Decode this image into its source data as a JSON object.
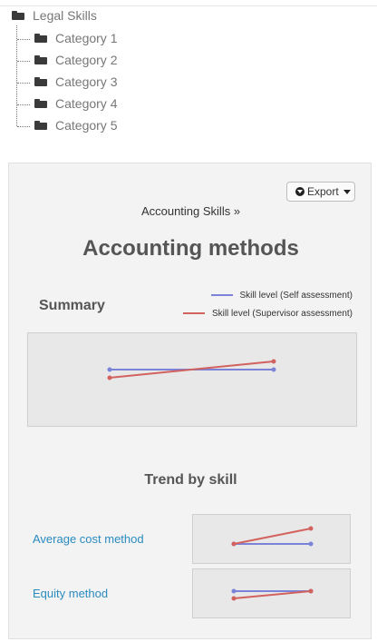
{
  "tree": {
    "root": "Legal Skills",
    "categories": [
      "Category 1",
      "Category 2",
      "Category 3",
      "Category 4",
      "Category 5"
    ]
  },
  "panel": {
    "export_label": "Export",
    "breadcrumb": "Accounting Skills »",
    "title": "Accounting methods",
    "summary_label": "Summary",
    "trend_title": "Trend by skill",
    "skills": [
      "Average cost method",
      "Equity method"
    ]
  },
  "chart_data": [
    {
      "type": "line",
      "name": "summary",
      "x": [
        1,
        2
      ],
      "series": [
        {
          "name": "Skill level (Self assessment)",
          "color": "#7b83d9",
          "values": [
            3.0,
            3.0
          ]
        },
        {
          "name": "Skill level (Supervisor assessment)",
          "color": "#d2625e",
          "values": [
            2.6,
            3.4
          ]
        }
      ],
      "legend": "top-right",
      "grid": false
    },
    {
      "type": "line",
      "name": "average-cost-method",
      "x": [
        1,
        2
      ],
      "series": [
        {
          "color": "#7b83d9",
          "values": [
            3.0,
            3.0
          ]
        },
        {
          "color": "#d2625e",
          "values": [
            3.0,
            3.9
          ]
        }
      ],
      "grid": false
    },
    {
      "type": "line",
      "name": "equity-method",
      "x": [
        1,
        2
      ],
      "series": [
        {
          "color": "#7b83d9",
          "values": [
            3.2,
            3.2
          ]
        },
        {
          "color": "#d2625e",
          "values": [
            2.7,
            3.2
          ]
        }
      ],
      "grid": false
    }
  ]
}
